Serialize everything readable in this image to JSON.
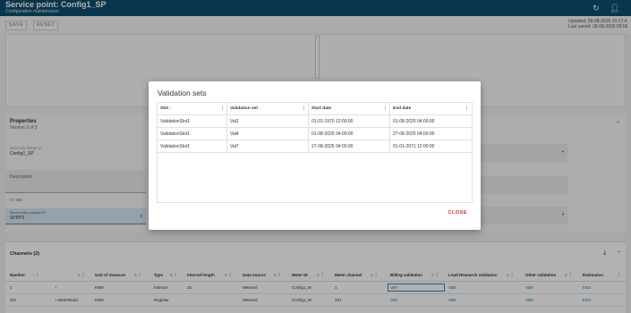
{
  "header": {
    "title": "Service point: Config1_SP",
    "subtitle": "Configuration maintenance",
    "refresh_icon": "refresh-icon",
    "user_icon": "user-icon"
  },
  "toolbar": {
    "save_label": "SAVE",
    "reset_label": "RESET",
    "updated": "Updated: 28-08-2025 10:17:4",
    "last_saved": "Last saved: 28-08-2025 09:56"
  },
  "properties": {
    "title": "Properties",
    "version": "Version 3 of 3",
    "service_point_id_label": "SERVICE POINT ID",
    "service_point_id_value": "Config1_SP",
    "description_label": "Description",
    "char_count": "0 / 180",
    "program_label": "Service point program ID*",
    "program_value": "SPPP3"
  },
  "channels": {
    "title": "Channels (2)",
    "columns": [
      "Number",
      "Unit of measure",
      "Type",
      "Interval length",
      "Data source",
      "Meter ID",
      "Meter channel",
      "Billing validation",
      "Load Research validation",
      "Other validation",
      "Estimation"
    ],
    "rows": [
      {
        "number": "1",
        "name": "I",
        "uom": "KWH",
        "type": "Interval",
        "interval": "15",
        "source": "Metered",
        "meter_id": "Config1_M",
        "meter_channel": "1",
        "billing": "Val7",
        "load": "Val8",
        "other": "Val9",
        "estimation": "Est3"
      },
      {
        "number": "201",
        "name": "I MeterRead",
        "uom": "KWH",
        "type": "Register",
        "interval": "",
        "source": "Metered",
        "meter_id": "Config1_M",
        "meter_channel": "201",
        "billing": "Val7",
        "load": "Val8",
        "other": "Val9",
        "estimation": "Est3"
      }
    ]
  },
  "dialog": {
    "title": "Validation sets",
    "columns": {
      "slot": "Slot",
      "validation_set": "Validation set",
      "start_date": "Start date",
      "end_date": "End date"
    },
    "rows": [
      {
        "slot": "ValidationSlot1",
        "validation_set": "Val1",
        "start_date": "01-01-1970 12:00:00",
        "end_date": "01-08-2025 04:00:00"
      },
      {
        "slot": "ValidationSlot1",
        "validation_set": "Val4",
        "start_date": "01-08-2025 04:00:00",
        "end_date": "27-08-2025 04:00:00"
      },
      {
        "slot": "ValidationSlot1",
        "validation_set": "Val7",
        "start_date": "27-08-2025 04:00:00",
        "end_date": "01-01-2071 12:00:00"
      }
    ],
    "close_label": "CLOSE"
  },
  "colors": {
    "appbar": "#0d4e6e",
    "link": "#2f6fa3",
    "close": "#d32f2f"
  }
}
